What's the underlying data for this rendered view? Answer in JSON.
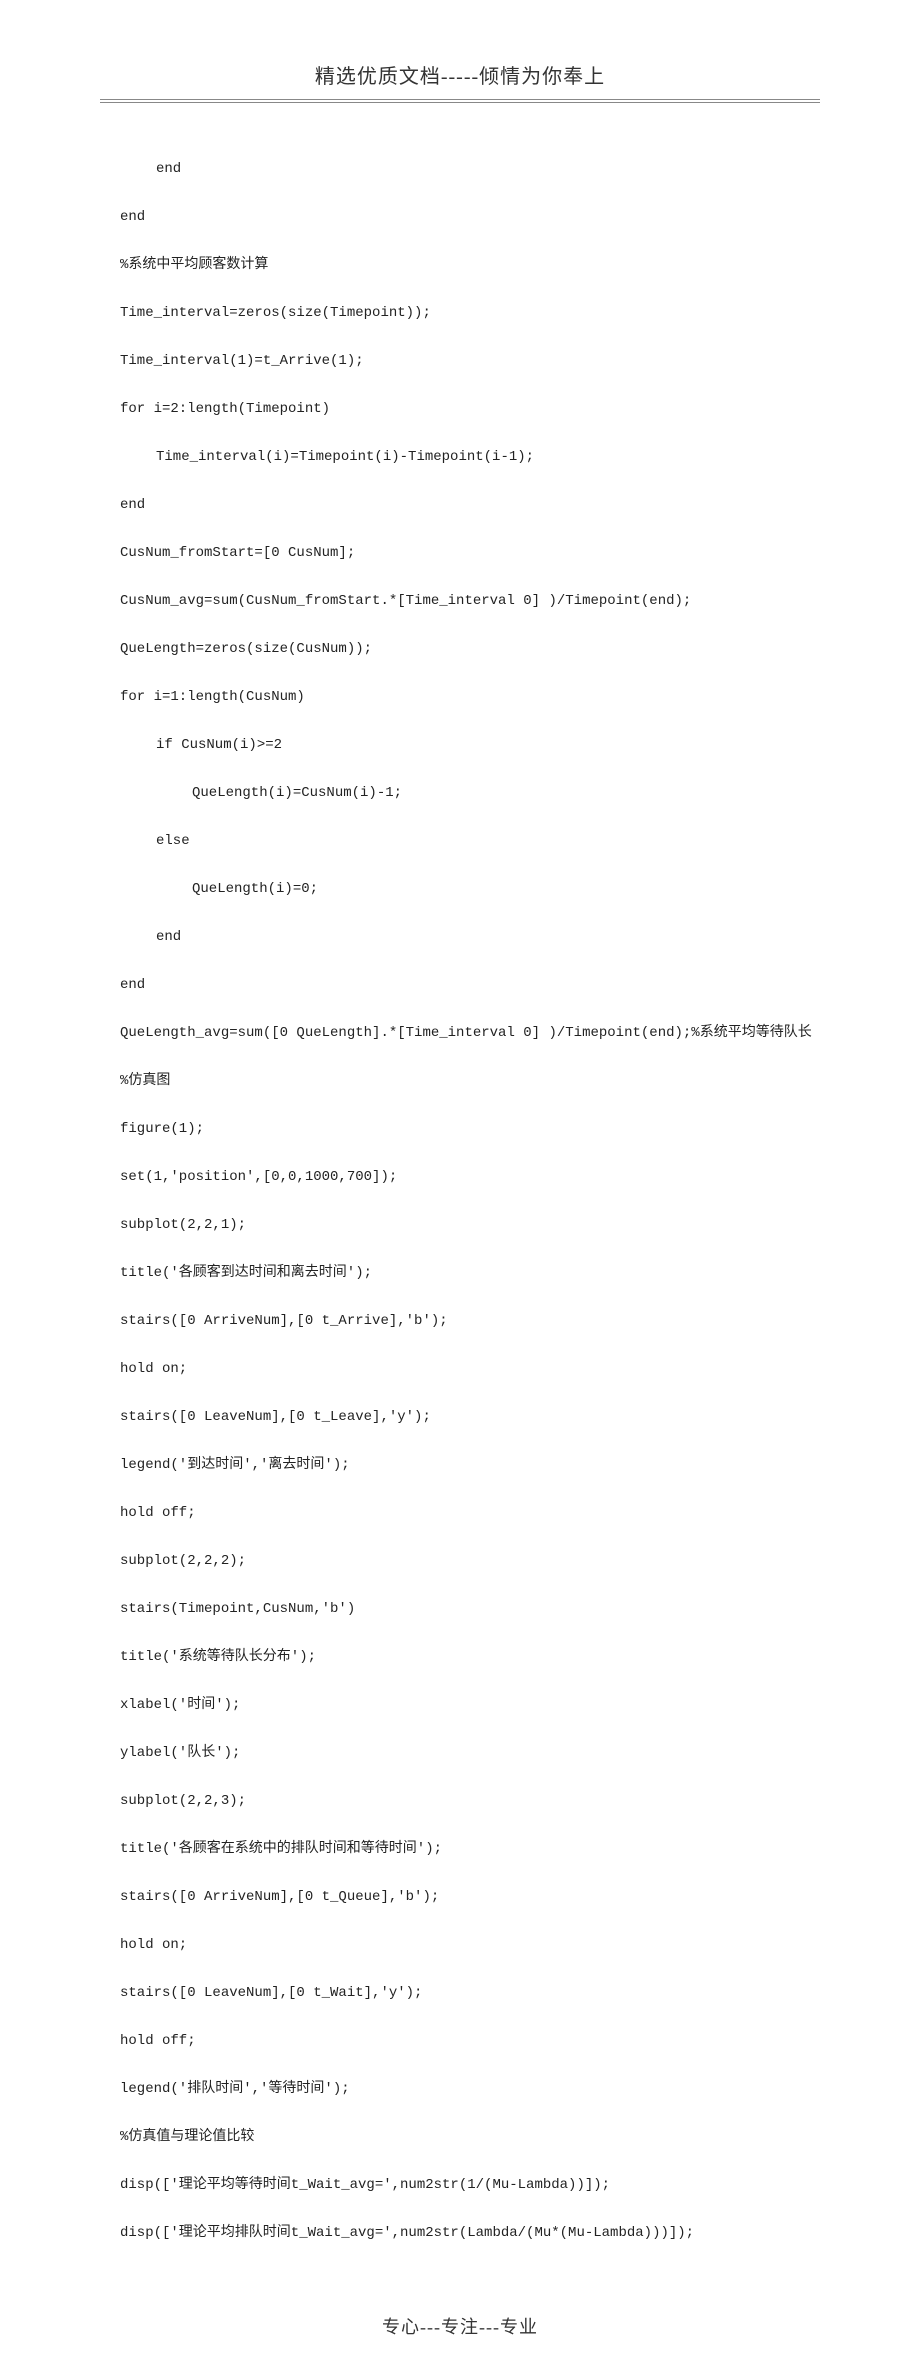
{
  "header": "精选优质文档-----倾情为你奉上",
  "footer": "专心---专注---专业",
  "code": {
    "l1": "end",
    "l2": "end",
    "l3": "%系统中平均顾客数计算",
    "l4": "Time_interval=zeros(size(Timepoint));",
    "l5": "Time_interval(1)=t_Arrive(1);",
    "l6": "for i=2:length(Timepoint)",
    "l7": "Time_interval(i)=Timepoint(i)-Timepoint(i-1);",
    "l8": "end",
    "l9": "CusNum_fromStart=[0 CusNum];",
    "l10": "CusNum_avg=sum(CusNum_fromStart.*[Time_interval 0] )/Timepoint(end);",
    "l11": "QueLength=zeros(size(CusNum));",
    "l12": "for i=1:length(CusNum)",
    "l13": "if CusNum(i)>=2",
    "l14": "QueLength(i)=CusNum(i)-1;",
    "l15": "else",
    "l16": "QueLength(i)=0;",
    "l17": "end",
    "l18": "end",
    "l19": "QueLength_avg=sum([0 QueLength].*[Time_interval 0] )/Timepoint(end);%系统平均等待队长",
    "l20": "%仿真图",
    "l21": "figure(1);",
    "l22": "set(1,'position',[0,0,1000,700]);",
    "l23": "subplot(2,2,1);",
    "l24": "title('各顾客到达时间和离去时间');",
    "l25": "stairs([0 ArriveNum],[0 t_Arrive],'b');",
    "l26": "hold on;",
    "l27": "stairs([0 LeaveNum],[0 t_Leave],'y');",
    "l28": "legend('到达时间','离去时间');",
    "l29": "hold off;",
    "l30": "subplot(2,2,2);",
    "l31": "stairs(Timepoint,CusNum,'b')",
    "l32": "title('系统等待队长分布');",
    "l33": "xlabel('时间');",
    "l34": "ylabel('队长');",
    "l35": "subplot(2,2,3);",
    "l36": "title('各顾客在系统中的排队时间和等待时间');",
    "l37": "stairs([0 ArriveNum],[0 t_Queue],'b');",
    "l38": "hold on;",
    "l39": "stairs([0 LeaveNum],[0 t_Wait],'y');",
    "l40": "hold off;",
    "l41": "legend('排队时间','等待时间');",
    "l42": "%仿真值与理论值比较",
    "l43": "disp(['理论平均等待时间t_Wait_avg=',num2str(1/(Mu-Lambda))]);",
    "l44": "disp(['理论平均排队时间t_Wait_avg=',num2str(Lambda/(Mu*(Mu-Lambda)))]);"
  }
}
